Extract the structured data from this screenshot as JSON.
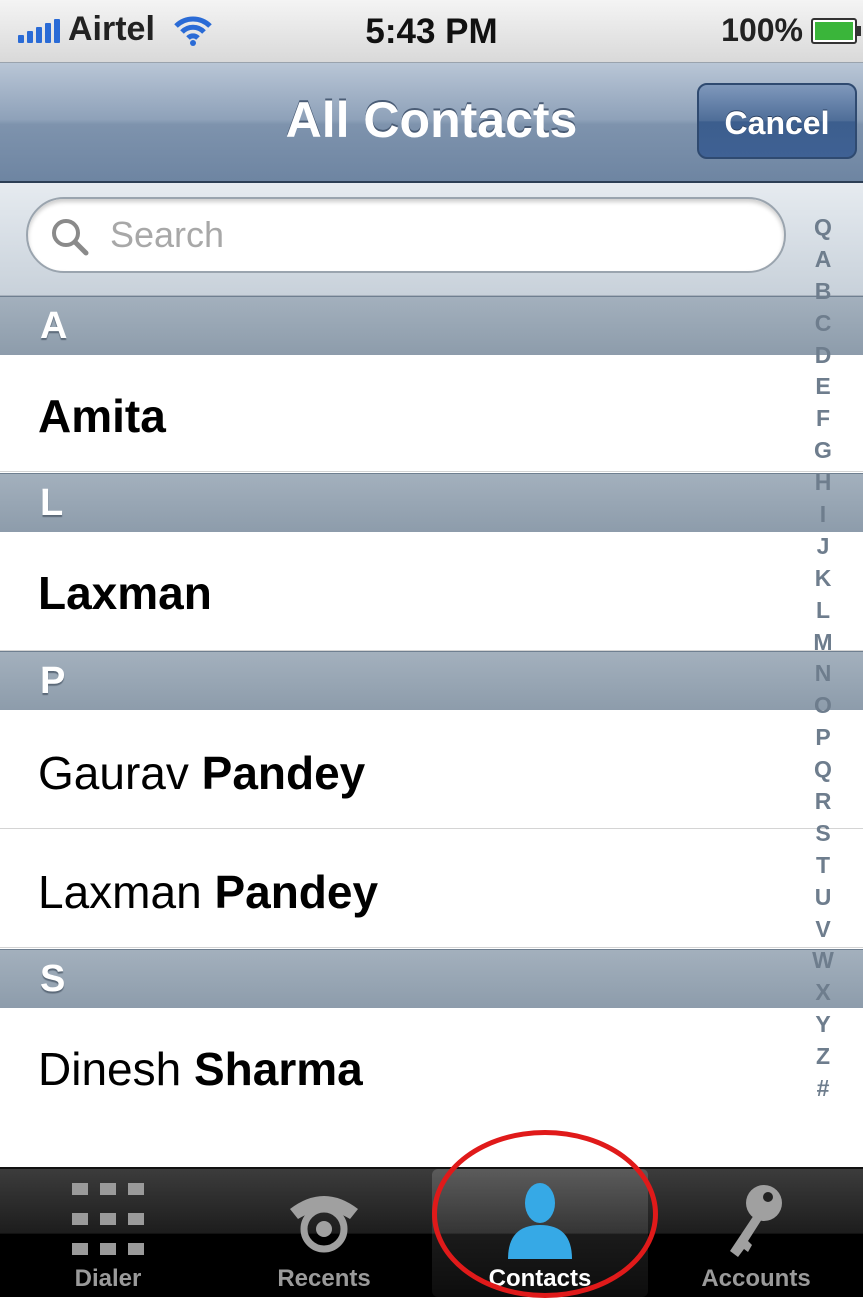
{
  "status_bar": {
    "carrier": "Airtel",
    "time": "5:43 PM",
    "battery": "100%"
  },
  "nav": {
    "title": "All Contacts",
    "cancel_label": "Cancel"
  },
  "search": {
    "placeholder": "Search"
  },
  "sections": [
    {
      "letter": "A",
      "contacts": [
        {
          "first": "Amita",
          "last": ""
        }
      ]
    },
    {
      "letter": "L",
      "contacts": [
        {
          "first": "Laxman",
          "last": ""
        }
      ]
    },
    {
      "letter": "P",
      "contacts": [
        {
          "first": "Gaurav",
          "last": "Pandey"
        },
        {
          "first": "Laxman",
          "last": "Pandey"
        }
      ]
    },
    {
      "letter": "S",
      "contacts": [
        {
          "first": "Dinesh",
          "last": "Sharma"
        }
      ]
    }
  ],
  "index": [
    "Q",
    "A",
    "B",
    "C",
    "D",
    "E",
    "F",
    "G",
    "H",
    "I",
    "J",
    "K",
    "L",
    "M",
    "N",
    "O",
    "P",
    "Q",
    "R",
    "S",
    "T",
    "U",
    "V",
    "W",
    "X",
    "Y",
    "Z",
    "#"
  ],
  "tabs": [
    {
      "label": "Dialer",
      "icon": "keypad-icon"
    },
    {
      "label": "Recents",
      "icon": "phone-icon"
    },
    {
      "label": "Contacts",
      "icon": "person-icon"
    },
    {
      "label": "Accounts",
      "icon": "key-icon"
    }
  ],
  "active_tab": "Contacts",
  "colors": {
    "highlight": "#e01a1a",
    "nav": "#7e93ad",
    "contacts_active": "#36a9e6"
  }
}
